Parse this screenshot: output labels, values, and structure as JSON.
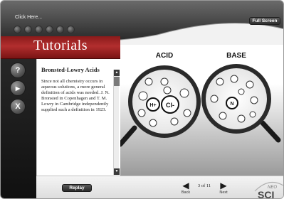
{
  "header": {
    "click_here": "Click Here...",
    "fullscreen_label": "Full Screen"
  },
  "nav_dots": 6,
  "tutorials": {
    "title": "Tutorials",
    "side_buttons": [
      {
        "icon": "question-icon",
        "glyph": "?"
      },
      {
        "icon": "play-icon",
        "glyph": "▶"
      },
      {
        "icon": "close-icon",
        "glyph": "X"
      }
    ]
  },
  "panel": {
    "heading": "Bronsted-Lowry Acids",
    "body": "Since not all chemistry occurs in aqueous solutions, a more general definition of acids was needed. J. N. Bronsted in Copenhagen and T. M. Lowry in Cambridge independently supplied such a definition in 1923."
  },
  "illustration": {
    "acid_label": "ACID",
    "base_label": "BASE",
    "acid_ions": [
      "H+",
      "Cl-"
    ],
    "base_ions": [
      "N"
    ]
  },
  "footer": {
    "replay_label": "Replay",
    "back_label": "Back",
    "next_label": "Next",
    "page_indicator": "3 of 11"
  },
  "logo": {
    "line1": "NEO",
    "line2": "SCI"
  },
  "colors": {
    "accent_red": "#a61e1e",
    "dark": "#2a2a2a"
  }
}
